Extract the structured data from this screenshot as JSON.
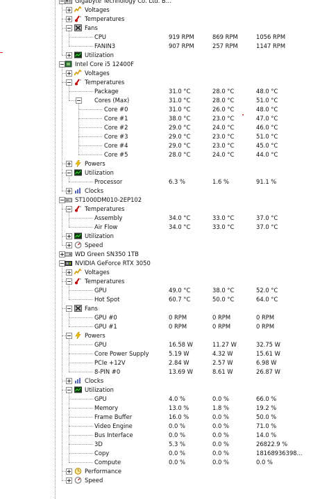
{
  "rows": [
    {
      "d": 1,
      "t": "Gigabyte Technology Co. Ltd. B...",
      "ic": "board-icon",
      "tg": "minus"
    },
    {
      "d": 2,
      "t": "Voltages",
      "ic": "voltage-icon",
      "tg": "plus"
    },
    {
      "d": 2,
      "t": "Temperatures",
      "ic": "thermometer-icon",
      "tg": "plus"
    },
    {
      "d": 2,
      "t": "Fans",
      "ic": "fan-icon",
      "tg": "minus"
    },
    {
      "d": 3,
      "t": "CPU",
      "v": [
        "919 RPM",
        "869 RPM",
        "1056 RPM"
      ]
    },
    {
      "d": 3,
      "t": "FANIN3",
      "v": [
        "907 RPM",
        "257 RPM",
        "1147 RPM"
      ]
    },
    {
      "d": 2,
      "t": "Utilization",
      "ic": "utilization-icon",
      "tg": "plus"
    },
    {
      "d": 1,
      "t": "Intel Core i5 12400F",
      "ic": "cpu-icon",
      "tg": "minus"
    },
    {
      "d": 2,
      "t": "Voltages",
      "ic": "voltage-icon",
      "tg": "plus"
    },
    {
      "d": 2,
      "t": "Temperatures",
      "ic": "thermometer-icon",
      "tg": "minus"
    },
    {
      "d": 3,
      "t": "Package",
      "v": [
        "31.0 °C",
        "28.0 °C",
        "48.0 °C"
      ]
    },
    {
      "d": 3,
      "t": "Cores (Max)",
      "v": [
        "31.0 °C",
        "28.0 °C",
        "51.0 °C"
      ],
      "tg": "minus"
    },
    {
      "d": 4,
      "t": "Core #0",
      "v": [
        "31.0 °C",
        "26.0 °C",
        "48.0 °C"
      ]
    },
    {
      "d": 4,
      "t": "Core #1",
      "v": [
        "38.0 °C",
        "23.0 °C",
        "47.0 °C"
      ]
    },
    {
      "d": 4,
      "t": "Core #2",
      "v": [
        "29.0 °C",
        "24.0 °C",
        "46.0 °C"
      ]
    },
    {
      "d": 4,
      "t": "Core #3",
      "v": [
        "29.0 °C",
        "23.0 °C",
        "51.0 °C"
      ]
    },
    {
      "d": 4,
      "t": "Core #4",
      "v": [
        "29.0 °C",
        "23.0 °C",
        "45.0 °C"
      ]
    },
    {
      "d": 4,
      "t": "Core #5",
      "v": [
        "28.0 °C",
        "24.0 °C",
        "44.0 °C"
      ]
    },
    {
      "d": 2,
      "t": "Powers",
      "ic": "power-icon",
      "tg": "plus"
    },
    {
      "d": 2,
      "t": "Utilization",
      "ic": "utilization-icon",
      "tg": "minus"
    },
    {
      "d": 3,
      "t": "Processor",
      "v": [
        "6.3 %",
        "1.6 %",
        "91.1 %"
      ]
    },
    {
      "d": 2,
      "t": "Clocks",
      "ic": "clock-icon",
      "tg": "plus"
    },
    {
      "d": 1,
      "t": "ST1000DM010-2EP102",
      "ic": "hdd-icon",
      "tg": "minus"
    },
    {
      "d": 2,
      "t": "Temperatures",
      "ic": "thermometer-icon",
      "tg": "minus"
    },
    {
      "d": 3,
      "t": "Assembly",
      "v": [
        "34.0 °C",
        "33.0 °C",
        "37.0 °C"
      ]
    },
    {
      "d": 3,
      "t": "Air Flow",
      "v": [
        "34.0 °C",
        "33.0 °C",
        "37.0 °C"
      ]
    },
    {
      "d": 2,
      "t": "Utilization",
      "ic": "utilization-icon",
      "tg": "plus"
    },
    {
      "d": 2,
      "t": "Speed",
      "ic": "speed-icon",
      "tg": "plus"
    },
    {
      "d": 1,
      "t": "WD Green SN350 1TB",
      "ic": "ssd-icon",
      "tg": "plus"
    },
    {
      "d": 1,
      "t": "NVIDIA GeForce RTX 3050",
      "ic": "gpu-icon",
      "tg": "minus"
    },
    {
      "d": 2,
      "t": "Voltages",
      "ic": "voltage-icon",
      "tg": "plus"
    },
    {
      "d": 2,
      "t": "Temperatures",
      "ic": "thermometer-icon",
      "tg": "minus"
    },
    {
      "d": 3,
      "t": "GPU",
      "v": [
        "49.0 °C",
        "38.0 °C",
        "52.0 °C"
      ]
    },
    {
      "d": 3,
      "t": "Hot Spot",
      "v": [
        "60.7 °C",
        "50.0 °C",
        "64.0 °C"
      ]
    },
    {
      "d": 2,
      "t": "Fans",
      "ic": "fan-icon",
      "tg": "minus"
    },
    {
      "d": 3,
      "t": "GPU #0",
      "v": [
        "0 RPM",
        "0 RPM",
        "0 RPM"
      ]
    },
    {
      "d": 3,
      "t": "GPU #1",
      "v": [
        "0 RPM",
        "0 RPM",
        "0 RPM"
      ]
    },
    {
      "d": 2,
      "t": "Powers",
      "ic": "power-icon",
      "tg": "minus"
    },
    {
      "d": 3,
      "t": "GPU",
      "v": [
        "16.58 W",
        "11.27 W",
        "32.75 W"
      ]
    },
    {
      "d": 3,
      "t": "Core Power Supply",
      "v": [
        "5.19 W",
        "4.32 W",
        "15.61 W"
      ]
    },
    {
      "d": 3,
      "t": "PCIe +12V",
      "v": [
        "2.84 W",
        "2.57 W",
        "6.98 W"
      ]
    },
    {
      "d": 3,
      "t": "8-PIN #0",
      "v": [
        "13.69 W",
        "8.61 W",
        "26.87 W"
      ]
    },
    {
      "d": 2,
      "t": "Clocks",
      "ic": "clock-icon",
      "tg": "plus"
    },
    {
      "d": 2,
      "t": "Utilization",
      "ic": "utilization-icon",
      "tg": "minus"
    },
    {
      "d": 3,
      "t": "GPU",
      "v": [
        "4.0 %",
        "0.0 %",
        "66.0 %"
      ]
    },
    {
      "d": 3,
      "t": "Memory",
      "v": [
        "13.0 %",
        "1.8 %",
        "19.2 %"
      ]
    },
    {
      "d": 3,
      "t": "Frame Buffer",
      "v": [
        "16.0 %",
        "0.0 %",
        "50.0 %"
      ]
    },
    {
      "d": 3,
      "t": "Video Engine",
      "v": [
        "0.0 %",
        "0.0 %",
        "71.0 %"
      ]
    },
    {
      "d": 3,
      "t": "Bus Interface",
      "v": [
        "0.0 %",
        "0.0 %",
        "14.0 %"
      ]
    },
    {
      "d": 3,
      "t": "3D",
      "v": [
        "5.3 %",
        "0.0 %",
        "26822.9 %"
      ]
    },
    {
      "d": 3,
      "t": "Copy",
      "v": [
        "0.0 %",
        "0.0 %",
        "18168936398..."
      ]
    },
    {
      "d": 3,
      "t": "Compute",
      "v": [
        "0.0 %",
        "0.0 %",
        "0.0 %"
      ]
    },
    {
      "d": 2,
      "t": "Performance",
      "ic": "performance-icon",
      "tg": "plus"
    },
    {
      "d": 2,
      "t": "Speed",
      "ic": "speed-icon",
      "tg": "plus"
    }
  ]
}
